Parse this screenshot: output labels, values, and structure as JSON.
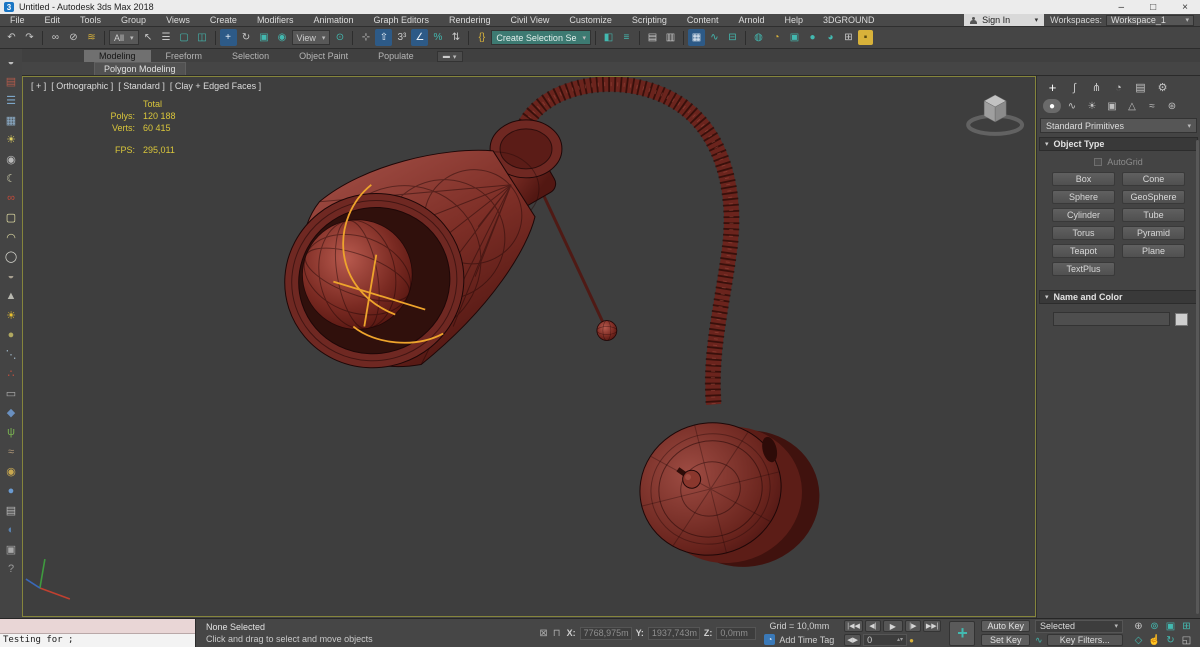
{
  "window": {
    "title": "Untitled - Autodesk 3ds Max 2018",
    "app_icon": "3",
    "minimize": "–",
    "maximize": "□",
    "close": "×"
  },
  "menus": [
    "File",
    "Edit",
    "Tools",
    "Group",
    "Views",
    "Create",
    "Modifiers",
    "Animation",
    "Graph Editors",
    "Rendering",
    "Civil View",
    "Customize",
    "Scripting",
    "Content",
    "Arnold",
    "Help",
    "3DGROUND"
  ],
  "account": {
    "sign_in": "Sign In",
    "workspaces_label": "Workspaces:",
    "workspace": "Workspace_1"
  },
  "icons": {
    "chevron": "▾"
  },
  "toolbar": {
    "filter_dropdown": "All",
    "coord_dropdown": "View",
    "selection_set_dropdown": "Create Selection Se",
    "glyphs": {
      "undo": "↶",
      "redo": "↷",
      "link": "∞",
      "unlink": "⊘",
      "bind": "≋",
      "select": "↖",
      "select_by_name": "☰",
      "region": "▢",
      "crossing": "◫",
      "move": "+",
      "rotate": "↻",
      "scale": "▣",
      "place": "◉",
      "pivot": "⊙",
      "manipulate": "⊹",
      "kbd_override": "⇧",
      "snap": "3³",
      "angle_snap": "∠",
      "percent_snap": "%",
      "spinner_snap": "⇅",
      "named_sets": "{}",
      "mirror": "◧",
      "align": "≡",
      "scene_explorer": "▤",
      "layer_explorer": "▥",
      "ribbon_toggle": "▦",
      "curve_editor": "∿",
      "schematic": "⊟",
      "material_editor": "◍",
      "render_setup": "◔",
      "rfw": "▣",
      "render": "●",
      "render2": "◕",
      "layouts": "⊞",
      "isolate": "▪"
    }
  },
  "ribbon": {
    "tabs": [
      "Modeling",
      "Freeform",
      "Selection",
      "Object Paint",
      "Populate"
    ],
    "more_glyph": "▬",
    "panel_label": "Polygon Modeling"
  },
  "leftbar": {
    "glyphs": {
      "teapot": "◒",
      "monitor": "▤",
      "list": "☰",
      "grid": "▦",
      "bulb": "☀",
      "camera": "◉",
      "moon": "☾",
      "glasses": "∞",
      "swatch": "▢",
      "dome": "◠",
      "ring": "◯",
      "teapot2": "◒",
      "cone": "▲",
      "sun": "☀",
      "sphere": "●",
      "scatter": "⋱",
      "molecule": "∴",
      "gamepad": "▭",
      "poly": "◆",
      "grass": "ψ",
      "bird": "≈",
      "coin": "◉",
      "marble": "●",
      "clipboard": "▤",
      "eclipse": "◐",
      "box": "▣",
      "help": "?"
    }
  },
  "viewport": {
    "label_general": "[ + ]",
    "label_pov": "[ Orthographic ]",
    "label_style1": "[ Standard ]",
    "label_style2": "[ Clay + Edged Faces ]",
    "stats": {
      "total_label": "Total",
      "polys_label": "Polys:",
      "polys_value": "120 188",
      "verts_label": "Verts:",
      "verts_value": "60 415",
      "fps_label": "FPS:",
      "fps_value": "295,011"
    }
  },
  "command_panel": {
    "tab_glyphs": {
      "create": "+",
      "modify": "∫",
      "hierarchy": "⋔",
      "motion": "◔",
      "display": "▤",
      "utilities": "⚙"
    },
    "subtab_glyphs": {
      "geometry": "●",
      "shapes": "∿",
      "lights": "☀",
      "cameras": "▣",
      "helpers": "△",
      "space_warps": "≈",
      "systems": "⊛"
    },
    "category_dropdown": "Standard Primitives",
    "object_type": {
      "title": "Object Type",
      "autogrid": "AutoGrid",
      "buttons": [
        "Box",
        "Cone",
        "Sphere",
        "GeoSphere",
        "Cylinder",
        "Tube",
        "Torus",
        "Pyramid",
        "Teapot",
        "Plane",
        "TextPlus"
      ]
    },
    "name_color": {
      "title": "Name and Color"
    }
  },
  "statusbar": {
    "listener_text": "Testing for ;",
    "status_line": "None Selected",
    "prompt_line": "Click and drag to select and move objects",
    "isolate_glyph": "⊠",
    "lock_glyph": "⊓",
    "x_label": "X:",
    "x_value": "7768,975m",
    "y_label": "Y:",
    "y_value": "1937,743m",
    "z_label": "Z:",
    "z_value": "0,0mm",
    "grid_label": "Grid = 10,0mm",
    "time_tag_glyph": "◔",
    "add_time_tag": "Add Time Tag",
    "playback": {
      "go_start": "|◀◀",
      "prev": "◀|",
      "play": "▶",
      "next": "|▶",
      "go_end": "▶▶|",
      "key_mode": "◀▶",
      "frame": "0",
      "spin_up": "▴",
      "spin_down": "▾",
      "key_glyph": "●"
    },
    "set_keys_glyph": "+",
    "auto_key": "Auto Key",
    "set_key": "Set Key",
    "selected_dropdown": "Selected",
    "tangent_glyph": "∿",
    "key_filters": "Key Filters...",
    "nav": {
      "zoom": "⊕",
      "zoom_all": "⊚",
      "zoom_extents": "▣",
      "zoom_extents_all": "⊞",
      "zoom_region": "◇",
      "pan": "☝",
      "orbit": "↻",
      "maximize": "◱"
    }
  },
  "colors": {
    "accent_teal": "#43b9b0",
    "highlight_blue": "#2d5a87",
    "stats_yellow": "#d9c63b",
    "model_red": "#8e3a30",
    "selection_yellow": "#eea42c",
    "viewport_bg": "#3e3e3e"
  }
}
